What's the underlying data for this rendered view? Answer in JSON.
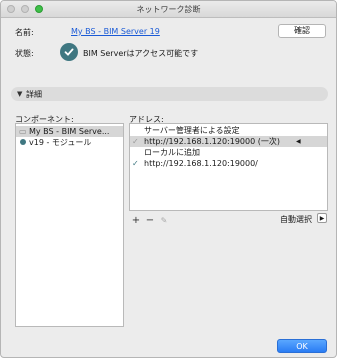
{
  "window": {
    "title": "ネットワーク診断"
  },
  "name_row": {
    "label": "名前:",
    "value": "My BS - BIM Server 19",
    "confirm_button": "確認"
  },
  "status_row": {
    "label": "状態:",
    "text": "BIM Serverはアクセス可能です"
  },
  "details": {
    "label": "詳細"
  },
  "components": {
    "header": "コンポーネント:",
    "items": [
      {
        "label": "My BS - BIM Serve..."
      },
      {
        "label": "v19 - モジュール"
      }
    ]
  },
  "addresses": {
    "header": "アドレス:",
    "rows": [
      {
        "text": "サーバー管理者による設定"
      },
      {
        "text": "http://192.168.1.120:19000 (一次)"
      },
      {
        "text": "ローカルに追加"
      },
      {
        "text": "http://192.168.1.120:19000/"
      }
    ]
  },
  "toolbar": {
    "add": "+",
    "remove": "−",
    "edit": "✎"
  },
  "auto_select": {
    "label": "自動選択",
    "arrow": "▶"
  },
  "ok_button": "OK"
}
